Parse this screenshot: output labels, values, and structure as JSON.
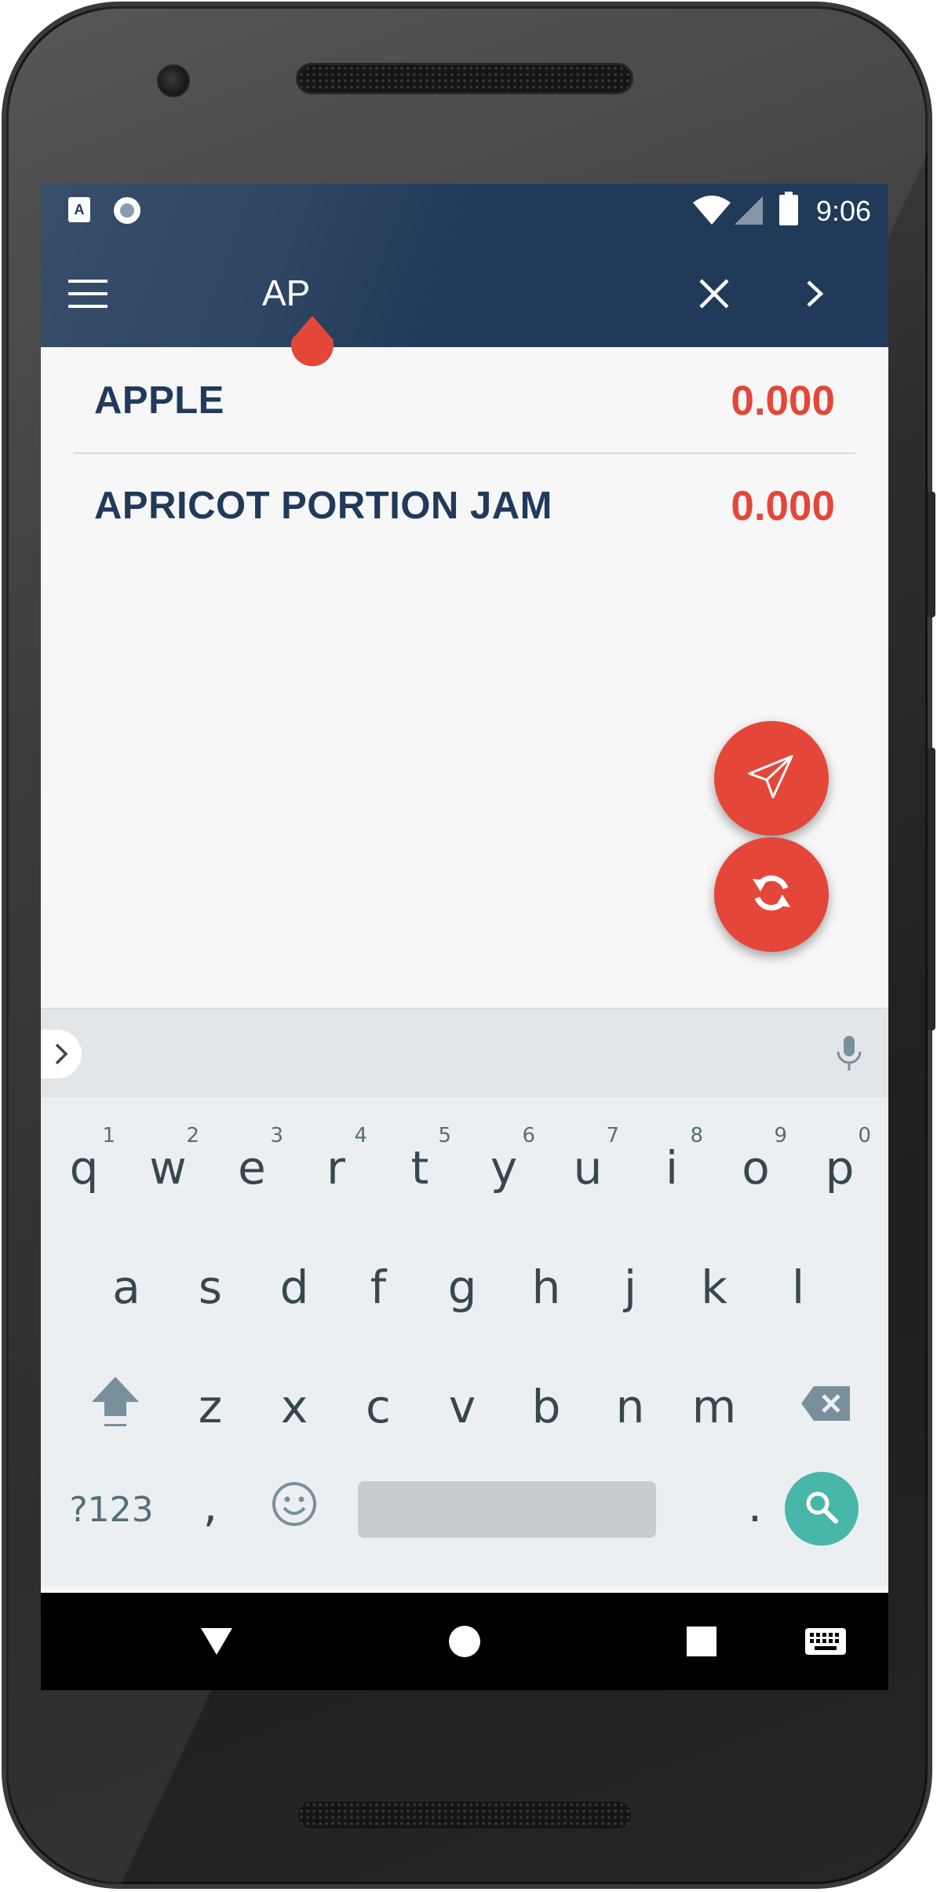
{
  "status_bar": {
    "time": "9:06",
    "left_icons": [
      "keyboard-a-icon",
      "record-icon"
    ],
    "right_icons": [
      "wifi-icon",
      "cell-signal-icon",
      "battery-icon"
    ]
  },
  "toolbar": {
    "search_text": "AP",
    "menu_icon": "hamburger-menu-icon",
    "clear_icon": "close-icon",
    "forward_icon": "chevron-right-icon",
    "background_color": "#213a59"
  },
  "items": [
    {
      "name": "APPLE",
      "quantity": "0.000"
    },
    {
      "name": "APRICOT PORTION JAM",
      "quantity": "0.000"
    }
  ],
  "fabs": {
    "send_icon": "send-icon",
    "sync_icon": "sync-icon",
    "color": "#e4473a"
  },
  "keyboard": {
    "row1": [
      {
        "key": "q",
        "hint": "1"
      },
      {
        "key": "w",
        "hint": "2"
      },
      {
        "key": "e",
        "hint": "3"
      },
      {
        "key": "r",
        "hint": "4"
      },
      {
        "key": "t",
        "hint": "5"
      },
      {
        "key": "y",
        "hint": "6"
      },
      {
        "key": "u",
        "hint": "7"
      },
      {
        "key": "i",
        "hint": "8"
      },
      {
        "key": "o",
        "hint": "9"
      },
      {
        "key": "p",
        "hint": "0"
      }
    ],
    "row2": [
      "a",
      "s",
      "d",
      "f",
      "g",
      "h",
      "j",
      "k",
      "l"
    ],
    "row3": [
      "z",
      "x",
      "c",
      "v",
      "b",
      "n",
      "m"
    ],
    "symbols_label": "?123",
    "comma": ",",
    "period": ".",
    "accent_color": "#48b6a9"
  },
  "nav_bar": {
    "icons": [
      "back-icon",
      "home-icon",
      "recents-icon",
      "keyboard-switch-icon"
    ]
  }
}
